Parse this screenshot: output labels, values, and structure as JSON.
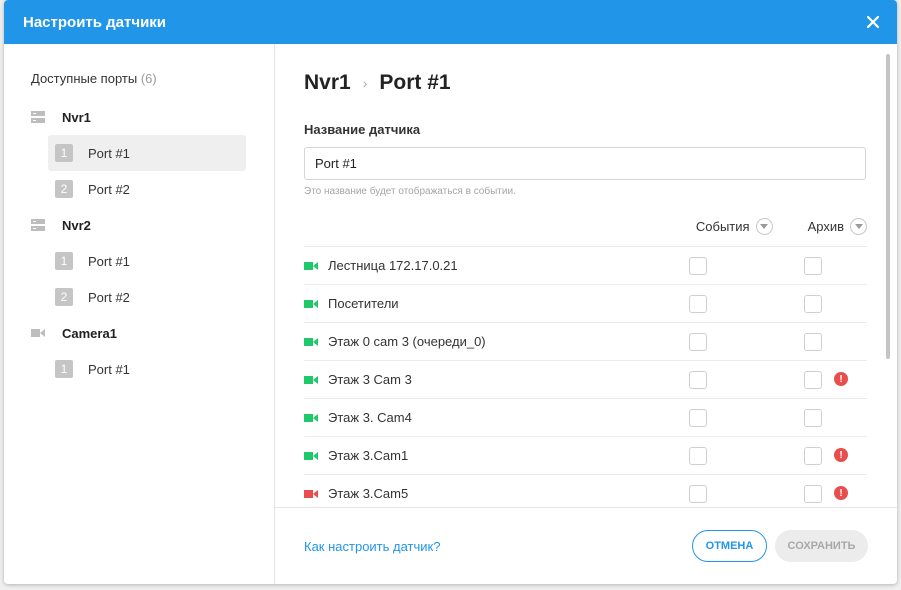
{
  "dialog": {
    "title": "Настроить датчики"
  },
  "left": {
    "title": "Доступные порты",
    "count": "(6)",
    "devices": [
      {
        "name": "Nvr1",
        "icon": "server-icon",
        "ports": [
          {
            "num": "1",
            "label": "Port #1",
            "active": true
          },
          {
            "num": "2",
            "label": "Port #2"
          }
        ]
      },
      {
        "name": "Nvr2",
        "icon": "server-icon",
        "ports": [
          {
            "num": "1",
            "label": "Port #1"
          },
          {
            "num": "2",
            "label": "Port #2"
          }
        ]
      },
      {
        "name": "Camera1",
        "icon": "camera-icon",
        "ports": [
          {
            "num": "1",
            "label": "Port #1"
          }
        ]
      }
    ]
  },
  "right": {
    "breadcrumb": {
      "device": "Nvr1",
      "separator": "›",
      "port": "Port #1"
    },
    "name_label": "Название датчика",
    "name_value": "Port #1",
    "hint": "Это название будет отображаться в событии.",
    "columns": {
      "events": "События",
      "archive": "Архив"
    },
    "rows": [
      {
        "label": "Лестница 172.17.0.21",
        "status": "green",
        "alert": false
      },
      {
        "label": "Посетители",
        "status": "green",
        "alert": false
      },
      {
        "label": "Этаж 0 cam 3 (очереди_0)",
        "status": "green",
        "alert": false
      },
      {
        "label": "Этаж 3 Cam 3",
        "status": "green",
        "alert": true
      },
      {
        "label": "Этаж 3. Cam4",
        "status": "green",
        "alert": false
      },
      {
        "label": "Этаж 3.Cam1",
        "status": "green",
        "alert": true
      },
      {
        "label": "Этаж 3.Cam5",
        "status": "red",
        "alert": true
      }
    ]
  },
  "footer": {
    "help_link": "Как настроить датчик?",
    "cancel": "ОТМЕНА",
    "save": "СОХРАНИТЬ"
  },
  "colors": {
    "accent": "#2196e8",
    "camera_online": "#1fc96b",
    "camera_offline": "#e94e4e",
    "alert": "#e94e4e"
  }
}
